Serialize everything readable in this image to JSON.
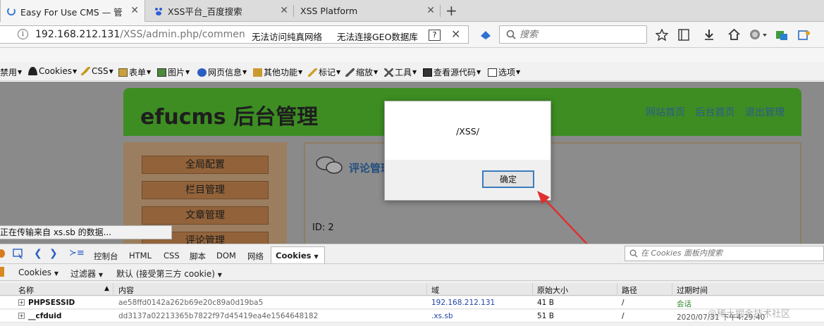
{
  "browser": {
    "tabs": [
      {
        "title": "Easy For Use CMS — 管",
        "active": true
      },
      {
        "title": "XSS平台_百度搜索",
        "active": false
      },
      {
        "title": "XSS Platform",
        "active": false
      }
    ],
    "url_host": "192.168.212.131",
    "url_path": "/XSS/admin.php/commen",
    "url_messages": [
      "无法访问纯真网络",
      "无法连接GEO数据库"
    ],
    "help_mark": "?",
    "search_placeholder": "搜索"
  },
  "toolbar": {
    "items": [
      "禁用",
      "Cookies",
      "CSS",
      "表单",
      "图片",
      "网页信息",
      "其他功能",
      "标记",
      "缩放",
      "工具",
      "查看源代码",
      "选项"
    ]
  },
  "cms": {
    "title": "efucms 后台管理",
    "links": [
      "网站首页",
      "后台首页",
      "退出管理"
    ],
    "menu": [
      "全局配置",
      "栏目管理",
      "文章管理",
      "评论管理"
    ],
    "section_title": "评论管理",
    "id_line": "ID: 2"
  },
  "alert": {
    "message": "/XSS/",
    "ok_label": "确定"
  },
  "status_text": "正在传输来自 xs.sb 的数据...",
  "devtools": {
    "tabs": [
      "控制台",
      "HTML",
      "CSS",
      "脚本",
      "DOM",
      "网络",
      "Cookies"
    ],
    "active_tab": "Cookies",
    "search_placeholder": "在 Cookies 面板内搜索",
    "sub_toolbar": [
      "Cookies",
      "过滤器",
      "默认 (接受第三方 cookie)"
    ],
    "columns": [
      "名称",
      "内容",
      "域",
      "原始大小",
      "路径",
      "过期时间"
    ],
    "rows": [
      {
        "name": "PHPSESSID",
        "content": "ae58ffd0142a262b69e20c89a0d19ba5",
        "domain": "192.168.212.131",
        "size": "41 B",
        "path": "/",
        "expires": "会话"
      },
      {
        "name": "__cfduid",
        "content": "dd3137a02213365b7822f97d45419ea4e1564648182",
        "domain": ".xs.sb",
        "size": "51 B",
        "path": "/",
        "expires": "2020/07/31 下午4:29:40"
      }
    ]
  },
  "watermark": "@稀土掘金技术社区",
  "colors": {
    "cms_header": "#3d8d23",
    "dialog_button_border": "#3b7bbf",
    "arrow": "#e03030"
  }
}
